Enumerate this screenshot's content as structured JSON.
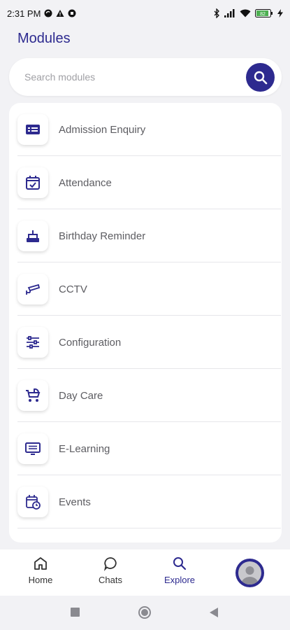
{
  "status_bar": {
    "time": "2:31 PM",
    "battery": "82"
  },
  "header": {
    "title": "Modules"
  },
  "search": {
    "placeholder": "Search modules"
  },
  "modules": [
    {
      "label": "Admission Enquiry",
      "icon": "id-card-icon"
    },
    {
      "label": "Attendance",
      "icon": "calendar-check-icon"
    },
    {
      "label": "Birthday Reminder",
      "icon": "cake-icon"
    },
    {
      "label": "CCTV",
      "icon": "cctv-camera-icon"
    },
    {
      "label": "Configuration",
      "icon": "sliders-icon"
    },
    {
      "label": "Day Care",
      "icon": "stroller-icon"
    },
    {
      "label": "E-Learning",
      "icon": "monitor-icon"
    },
    {
      "label": "Events",
      "icon": "calendar-clock-icon"
    }
  ],
  "nav": {
    "home": "Home",
    "chats": "Chats",
    "explore": "Explore"
  },
  "colors": {
    "accent": "#2d2a8f",
    "text_muted": "#5d5d62"
  }
}
